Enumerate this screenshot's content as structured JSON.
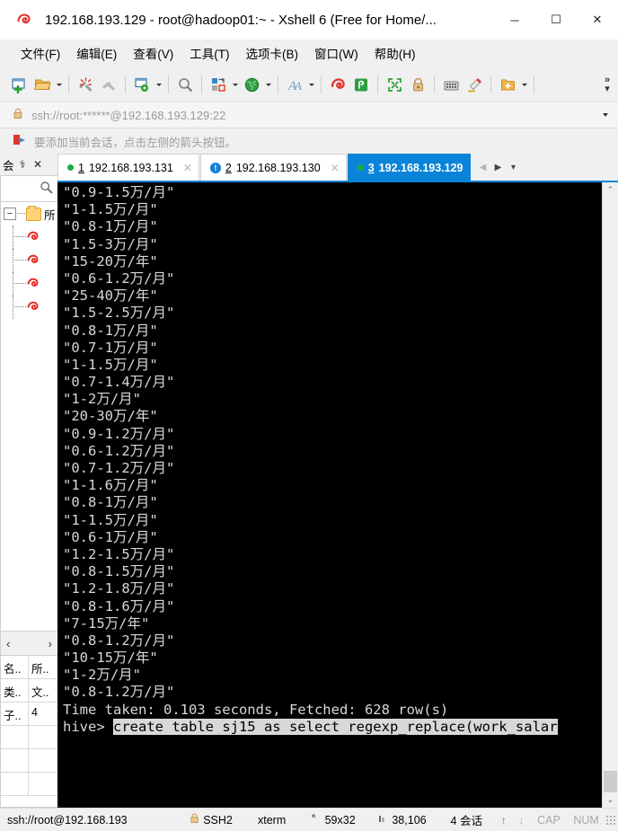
{
  "window": {
    "title": "192.168.193.129 - root@hadoop01:~ - Xshell 6 (Free for Home/...",
    "app_icon": "xshell-logo-icon",
    "minimize_label": "─",
    "maximize_label": "☐",
    "close_label": "✕"
  },
  "menubar": {
    "items": [
      {
        "label": "文件(F)",
        "name": "menu-file"
      },
      {
        "label": "编辑(E)",
        "name": "menu-edit"
      },
      {
        "label": "查看(V)",
        "name": "menu-view"
      },
      {
        "label": "工具(T)",
        "name": "menu-tools"
      },
      {
        "label": "选项卡(B)",
        "name": "menu-tabs"
      },
      {
        "label": "窗口(W)",
        "name": "menu-window"
      },
      {
        "label": "帮助(H)",
        "name": "menu-help"
      }
    ]
  },
  "toolbar": {
    "overflow_label": "»",
    "buttons": [
      "new-session-icon",
      "open-folder-icon",
      "disconnect-icon",
      "reconnect-icon",
      "session-properties-icon",
      "find-icon",
      "transfer-file-icon",
      "web-browser-icon",
      "font-icon",
      "xshell-icon",
      "xftp-icon",
      "fullscreen-icon",
      "lock-icon",
      "keyboard-icon",
      "highlight-icon",
      "add-folder-icon"
    ]
  },
  "address_bar": {
    "lock_icon": "lock-icon",
    "value": "ssh://root:******@192.168.193.129:22",
    "dropdown_icon": "chevron-down-icon"
  },
  "notice_bar": {
    "icon": "arrow-flag-icon",
    "text": "要添加当前会话，点击左侧的箭头按钮。"
  },
  "sidebar": {
    "title": "会",
    "pin_label": "⚕",
    "close_label": "✕",
    "search_icon": "search-icon",
    "root_label": "所",
    "expander_label": "−",
    "session_count": 4,
    "nav_prev": "‹",
    "nav_next": "›",
    "properties": [
      {
        "key": "名..",
        "value": "所.."
      },
      {
        "key": "类..",
        "value": "文.."
      },
      {
        "key": "子..",
        "value": "4"
      }
    ]
  },
  "tabs": {
    "items": [
      {
        "status": "connected",
        "num": "1",
        "label": "192.168.193.131",
        "active": false,
        "close": "✕"
      },
      {
        "status": "alert",
        "num": "2",
        "label": "192.168.193.130",
        "active": false,
        "close": "✕"
      },
      {
        "status": "connected",
        "num": "3",
        "label": "192.168.193.129",
        "active": true,
        "close": ""
      }
    ],
    "nav_prev": "◀",
    "nav_next": "▶",
    "nav_menu": "▾"
  },
  "terminal": {
    "lines": [
      "\"0.9-1.5万/月\"",
      "\"1-1.5万/月\"",
      "\"0.8-1万/月\"",
      "\"1.5-3万/月\"",
      "\"15-20万/年\"",
      "\"0.6-1.2万/月\"",
      "\"25-40万/年\"",
      "\"1.5-2.5万/月\"",
      "\"0.8-1万/月\"",
      "\"0.7-1万/月\"",
      "\"1-1.5万/月\"",
      "\"0.7-1.4万/月\"",
      "\"1-2万/月\"",
      "\"20-30万/年\"",
      "\"0.9-1.2万/月\"",
      "\"0.6-1.2万/月\"",
      "\"0.7-1.2万/月\"",
      "\"1-1.6万/月\"",
      "\"0.8-1万/月\"",
      "\"1-1.5万/月\"",
      "\"0.6-1万/月\"",
      "\"1.2-1.5万/月\"",
      "\"0.8-1.5万/月\"",
      "\"1.2-1.8万/月\"",
      "\"0.8-1.6万/月\"",
      "\"7-15万/年\"",
      "\"0.8-1.2万/月\"",
      "\"10-15万/年\"",
      "\"1-2万/月\"",
      "\"0.8-1.2万/月\"",
      "Time taken: 0.103 seconds, Fetched: 628 row(s)"
    ],
    "prompt": "hive> ",
    "command": "create table sj15 as select regexp_replace(work_salar",
    "scroll_up": "⌃",
    "scroll_down": "⌄"
  },
  "statusbar": {
    "path": "ssh://root@192.168.193",
    "lock_icon": "lock-icon",
    "protocol": "SSH2",
    "term_type": "xterm",
    "size_icon": "size-icon",
    "size": "59x32",
    "pos_icon": "position-icon",
    "position": "38,106",
    "sessions": "4 会话",
    "tx": "↑",
    "rx": "↓",
    "cap": "CAP",
    "num": "NUM"
  },
  "colors": {
    "accent": "#0a84d8",
    "chrome": "#f0f0f0",
    "terminal_bg": "#000000",
    "terminal_fg": "#d8d8d8",
    "connected": "#1faa43"
  }
}
